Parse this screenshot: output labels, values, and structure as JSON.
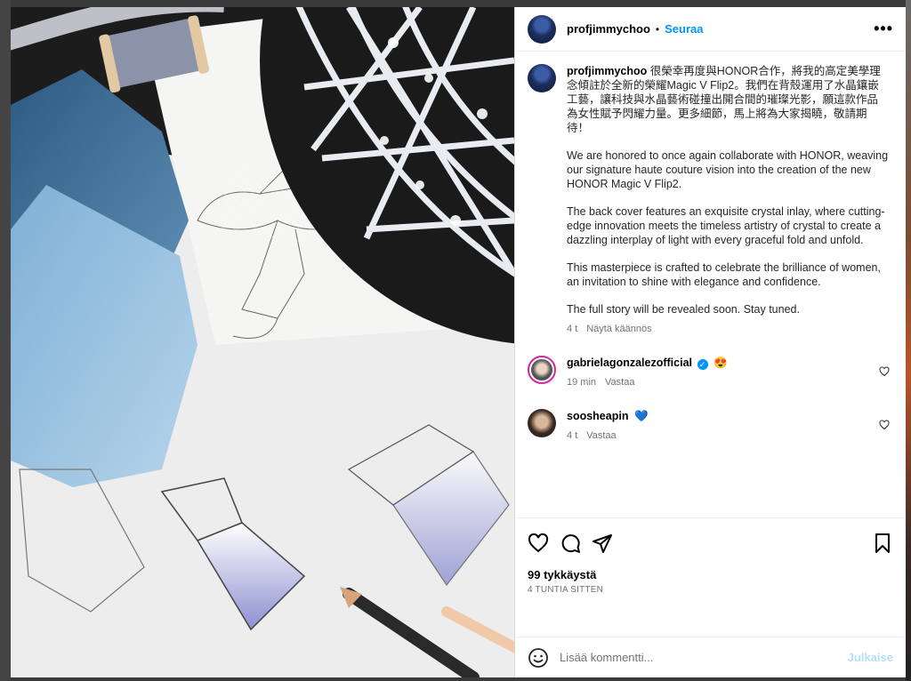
{
  "post": {
    "author": "profjimmychoo",
    "separator": "•",
    "follow_label": "Seuraa",
    "more_label": "•••",
    "caption": {
      "zh": "很榮幸再度與HONOR合作，將我的高定美學理念傾註於全新的榮耀Magic V Flip2。我們在背殼運用了水晶鑲嵌工藝，讓科技與水晶藝術碰撞出開合間的璀璨光影，願這款作品為女性賦予閃耀力量。更多細節，馬上將為大家揭曉，敬請期待！",
      "p1": "We are honored to once again collaborate with HONOR, weaving our signature haute couture vision into the creation of the new HONOR Magic V Flip2.",
      "p2": "The back cover features an exquisite crystal inlay, where cutting-edge innovation meets the timeless artistry of crystal to create a dazzling interplay of light with every graceful fold and unfold.",
      "p3": "This masterpiece is crafted to celebrate the brilliance of women, an invitation to shine with elegance and confidence.",
      "p4": "The full story will be revealed soon. Stay tuned.",
      "time": "4 t",
      "translate_label": "Näytä käännös"
    },
    "comments": [
      {
        "user": "gabrielagonzalezofficial",
        "verified_mark": "✓",
        "emoji": "😍",
        "time": "19 min",
        "reply_label": "Vastaa"
      },
      {
        "user": "soosheapin",
        "emoji": "💙",
        "time": "4 t",
        "reply_label": "Vastaa"
      }
    ],
    "likes": "99 tykkäystä",
    "posted_ago": "4 TUNTIA SITTEN",
    "comment_placeholder": "Lisää kommentti...",
    "post_button": "Julkaise"
  },
  "colors": {
    "accent": "#0095f6",
    "post_button_disabled": "#b2dffc",
    "story_ring": "#d6249f"
  },
  "icons": [
    "ellipsis-icon",
    "heart-icon",
    "comment-icon",
    "share-icon",
    "bookmark-icon",
    "smiley-icon",
    "verified-badge-icon"
  ]
}
